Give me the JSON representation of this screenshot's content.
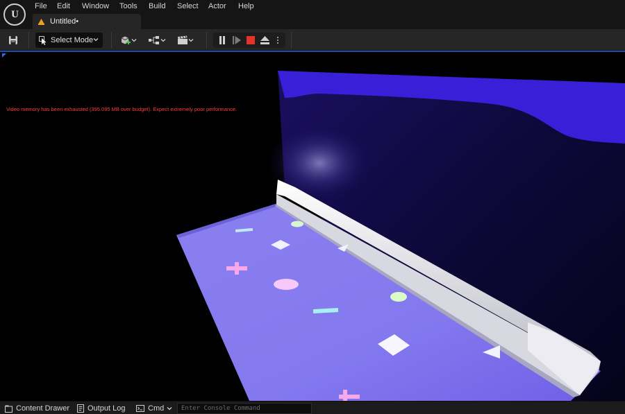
{
  "app": {
    "logo_text": "U",
    "menu": [
      "File",
      "Edit",
      "Window",
      "Tools",
      "Build",
      "Select",
      "Actor",
      "Help"
    ]
  },
  "document_tab": {
    "title": "Untitled•"
  },
  "toolbar": {
    "save_icon": "save-icon",
    "mode_label": "Select Mode",
    "add_icon": "add-actor-icon",
    "blueprint_icon": "blueprint-icon",
    "cinematics_icon": "clapper-icon",
    "play_controls": [
      "pause-icon",
      "step-icon",
      "stop-icon",
      "eject-icon",
      "more-icon"
    ]
  },
  "viewport": {
    "warning": "Video memory has been exhausted (395.095 MB over budget). Expect extremely poor performance."
  },
  "bottom_bar": {
    "content_drawer": "Content Drawer",
    "output_log": "Output Log",
    "cmd": "Cmd",
    "console_placeholder": "Enter Console Command"
  },
  "colors": {
    "accent_blue": "#1f4bb0",
    "stop_red": "#e5332b",
    "warning_red": "#ff3b3b",
    "wall_purple": "#3a1fd8",
    "floor_violet": "#8a80f0"
  }
}
